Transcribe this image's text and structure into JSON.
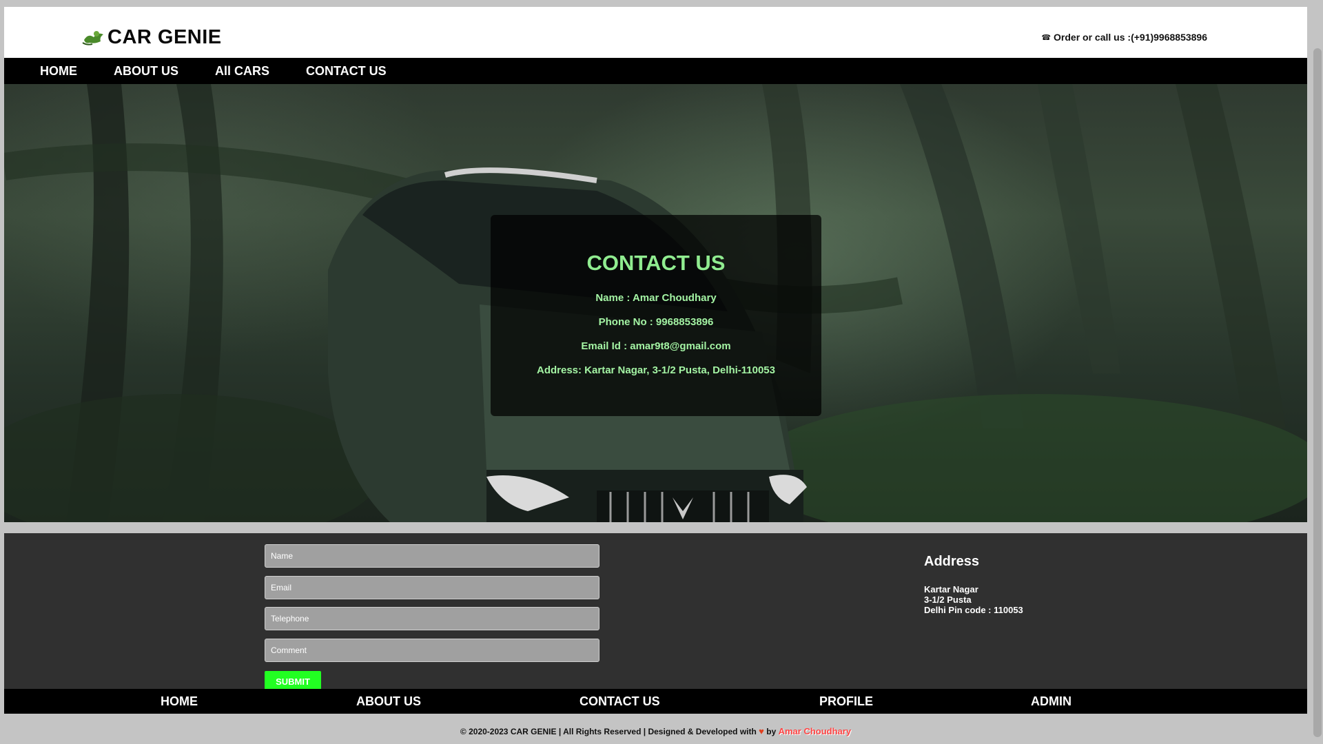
{
  "header": {
    "logo_text": "CAR GENIE",
    "phone_text": "Order or call us :(+91)9968853896"
  },
  "nav": {
    "items": [
      "HOME",
      "ABOUT US",
      "All CARS",
      "CONTACT US"
    ]
  },
  "contact": {
    "title": "CONTACT US",
    "name": "Name : Amar Choudhary",
    "phone": "Phone No : 9968853896",
    "email": "Email Id : amar9t8@gmail.com",
    "address": "Address: Kartar Nagar, 3-1/2 Pusta, Delhi-110053"
  },
  "form": {
    "name_placeholder": "Name",
    "email_placeholder": "Email",
    "telephone_placeholder": "Telephone",
    "comment_placeholder": "Comment",
    "submit_label": "SUBMIT"
  },
  "address_block": {
    "heading": "Address",
    "line1": "Kartar Nagar",
    "line2": "3-1/2 Pusta",
    "line3": "Delhi Pin code : 110053"
  },
  "footer_nav": {
    "items": [
      "HOME",
      "ABOUT US",
      "CONTACT US",
      "PROFILE",
      "ADMIN"
    ]
  },
  "footer": {
    "copyright": "© 2020-2023 CAR GENIE | All Rights Reserved | Designed & Developed with",
    "by": "by",
    "author": "Amar Choudhary"
  },
  "colors": {
    "contact_text": "#90ec90",
    "submit_bg": "#22ff22",
    "author": "#ff4444"
  }
}
